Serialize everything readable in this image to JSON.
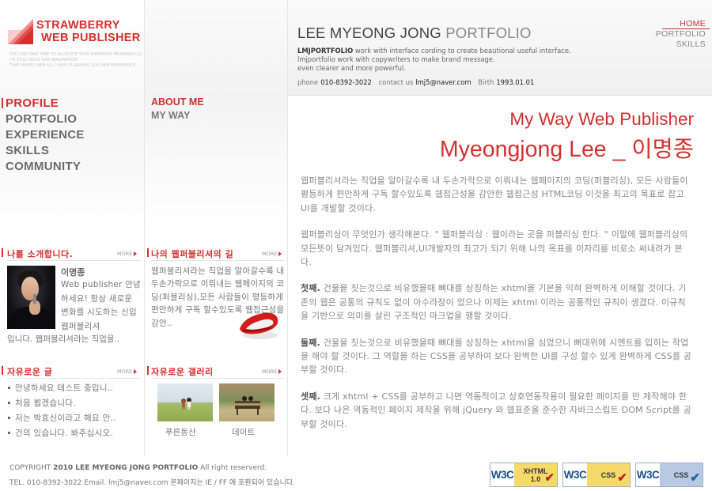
{
  "logo": {
    "line1": "STRAWBERRY",
    "line2": "WEB PUBLISHER",
    "taglines": [
      "YOU CAN TAKE TIME TO ALLOCATE YOUR MEMORIES MEANINGFULLY BOTH",
      "I'M STILL TRULY HAS IMAGINATION",
      "THAT MAKES WEB ALL I HAVE IS MAKING YOU WEB EXPERIENCE"
    ]
  },
  "main_nav": [
    "PROFILE",
    "PORTFOLIO",
    "EXPERIENCE",
    "SKILLS",
    "COMMUNITY"
  ],
  "sub_nav": [
    "ABOUT ME",
    "MY WAY"
  ],
  "top_links": [
    "HOME",
    "PORTFOLIO",
    "SKILLS"
  ],
  "header": {
    "title_bold": "LEE MYEONG JONG",
    "title_light": "PORTFOLIO",
    "intro_brand": "LMJPORTFOLIO",
    "intro_line1": " work with interface cording to create beautional useful interface.",
    "intro_line2": "lmjportfolio work with copywriters to make brand message.",
    "intro_line3": "even clearer and more powerful.",
    "phone_label": "phone",
    "phone": "010-8392-3022",
    "contact_label": "contact us",
    "email": "lmj5@naver.com",
    "birth_label": "Birth",
    "birth": "1993.01.01"
  },
  "profile_box": {
    "title": "나를 소개합니다.",
    "more": "MORE",
    "name": "이명종",
    "body": "Web publisher 안녕하세요! 항상 새로운 변화를 시도하는 신입 웹퍼블리셔",
    "body_tail": "입니다. 웹퍼블리셔라는 직업을.."
  },
  "way_box": {
    "title": "나의 웹퍼블리셔의 길",
    "more": "MORE",
    "body": "웹퍼블리셔라는 직업을 알아갈수록 내두손가락으로 이뤄내는 웹페이지의 코딩(퍼블리싱),모든 사람들이 평등하게 편안하게 구독 할수있도록 웹접근성을 감안.."
  },
  "free_board": {
    "title": "자유로운 글",
    "more": "MORE",
    "items": [
      "안녕하세요 테스트 중입니..",
      "처음 뵙겠습니다.",
      "저는 박효신이라고 해요 안..",
      "건의 있습니다. 봐주십시오."
    ]
  },
  "gallery": {
    "title": "자유로운 갤러리",
    "more": "MORE",
    "captions": [
      "푸른동산",
      "데이트"
    ]
  },
  "content": {
    "headline1": "My Way Web Publisher",
    "headline2": "Myeongjong Lee _ 이명종",
    "p1": "웹퍼블리셔라는 직업을 알아갈수록 내 두손가락으로 이뤄내는 웹페이지의 코딩(퍼블리싱), 모든 사람들이 평등하게 편안하게 구독 할수있도록 웹접근성을 감안한 웹접근성 HTML코딩 이것을 최고의 목표로 잡고 UI를 개발할 것이다.",
    "p2": "웹퍼블리싱이 무엇인가 생각해본다. \" 웹퍼블리싱 : 웹이라는 곳을 퍼블리싱 한다. \" 이말에 웹퍼블리싱의 모든뜻이 담겨있다. 웹퍼블리셔,UI개발자의 최고가 되기 위해 나의 목표를 이자리를 비로소 써내려가 본다.",
    "p3_lead": "첫째.",
    "p3": " 건물을 짓는것으로 비유했을때 뼈대를 상징하는 xhtml을 기본을 익혀 완벽하게 이해할 것이다. 기존의 웹은 공통의 규칙도 없이 아수라장이 었으나 이제는 xhtml 이라는 공통적인 규칙이 생겼다. 이규칙을 기반으로 의미를 살린 구조적인 마크업을 행할 것이다.",
    "p4_lead": "둘째.",
    "p4": " 건물을 짓는것으로 비유했을때 뼈대를 상징하는 xhtml을 심었으니 뼈대위에 시멘트를 입히는 작업을 해야 할 것이다. 그 역할을 하는 CSS을 공부하여 보다 완벽한 UI를 구성 할수 있게 완벽하게 CSS를 공부할 것이다.",
    "p5_lead": "셋째.",
    "p5": " 크게 xhtml + CSS를 공부하고 나면 역동적이고 상호연동작용이 필요한 페이지를 만 제작해야 한다. 보다 나은 역동적인 페이지 제작을 위해 jQuery 와 웹표준을 준수한 자바크스립트 DOM Script를 공부할 것이다."
  },
  "footer": {
    "copy_prefix": "COPYRIGHT",
    "copy_bold": "2010 LEE MYEONG JONG PORTFOLIO",
    "copy_suffix": "All right reserverd.",
    "line2": "TEL. 010-8392-3022 Email. lmj5@naver.com 본페이지는 IE / FF 에 호환되어 있습니다."
  },
  "badges": [
    {
      "w3c": "W3C",
      "label1": "XHTML",
      "label2": "1.0",
      "check_color": "#c31f1f"
    },
    {
      "w3c": "W3C",
      "label1": "CSS",
      "label2": "",
      "check_color": "#c31f1f"
    },
    {
      "w3c": "W3C",
      "label1": "CSS",
      "label2": "",
      "check_color": "#1d5cb2"
    }
  ],
  "colors": {
    "accent": "#d62f2f",
    "text": "#777777"
  }
}
